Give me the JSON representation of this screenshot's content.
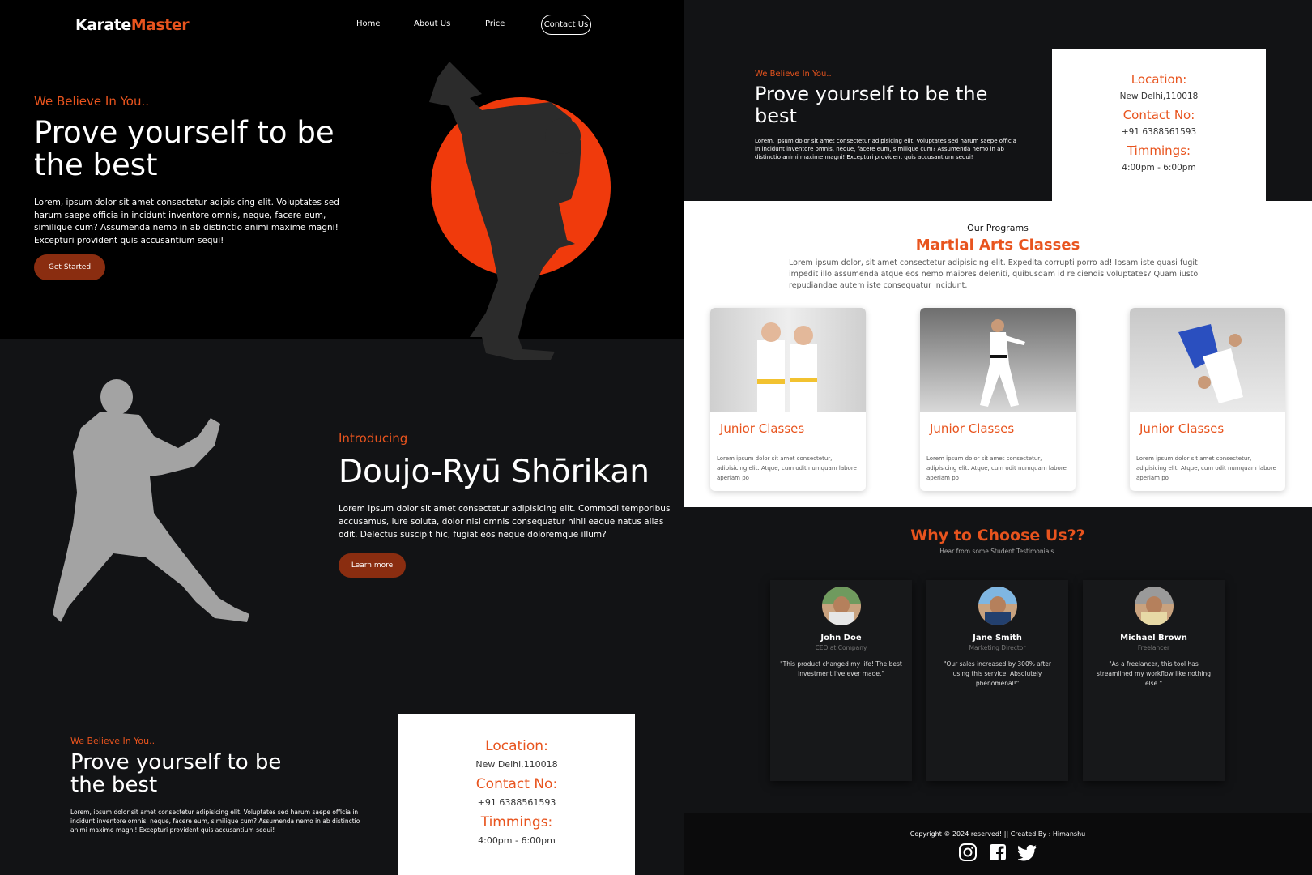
{
  "nav": {
    "logo_a": "Karate",
    "logo_b": "Master",
    "items": [
      "Home",
      "About Us",
      "Price",
      "Contact Us"
    ]
  },
  "hero": {
    "kicker": "We Believe In You..",
    "title": "Prove yourself to be the best",
    "body": "Lorem, ipsum dolor sit amet consectetur adipisicing elit. Voluptates sed harum saepe officia in incidunt inventore omnis, neque, facere eum, similique cum? Assumenda nemo in ab distinctio animi maxime magni! Excepturi provident quis accusantium sequi!",
    "button": "Get Started"
  },
  "intro": {
    "kicker": "Introducing",
    "title": "Doujo-Ryū Shōrikan",
    "body": "Lorem ipsum dolor sit amet consectetur adipisicing elit. Commodi temporibus accusamus, iure soluta, dolor nisi omnis consequatur nihil eaque natus alias odit. Delectus suscipit hic, fugiat eos neque doloremque illum?",
    "button": "Learn more"
  },
  "location_section": {
    "kicker": "We Believe In You..",
    "title": "Prove yourself to be the best",
    "body": "Lorem, ipsum dolor sit amet consectetur adipisicing elit. Voluptates sed harum saepe officia in incidunt inventore omnis, neque, facere eum, similique cum? Assumenda nemo in ab distinctio animi maxime magni! Excepturi provident quis accusantium sequi!",
    "card": {
      "location_label": "Location:",
      "location": "New Delhi,110018",
      "contact_label": "Contact No:",
      "contact": "+91 6388561593",
      "timings_label": "Timmings:",
      "timings": "4:00pm - 6:00pm"
    }
  },
  "programs": {
    "label": "Our Programs",
    "title": "Martial Arts Classes",
    "body": "Lorem ipsum dolor, sit amet consectetur adipisicing elit. Expedita corrupti porro ad! Ipsam iste quasi fugit impedit illo assumenda atque eos nemo maiores deleniti, quibusdam id reiciendis voluptates? Quam iusto repudiandae autem iste consequatur incidunt.",
    "cards": [
      {
        "title": "Junior Classes",
        "body": "Lorem ipsum dolor sit amet consectetur, adipisicing elit. Atque, cum odit numquam labore aperiam po"
      },
      {
        "title": "Junior Classes",
        "body": "Lorem ipsum dolor sit amet consectetur, adipisicing elit. Atque, cum odit numquam labore aperiam po"
      },
      {
        "title": "Junior Classes",
        "body": "Lorem ipsum dolor sit amet consectetur, adipisicing elit. Atque, cum odit numquam labore aperiam po"
      }
    ]
  },
  "testimonials": {
    "title": "Why to Choose Us??",
    "subtitle": "Hear from some Student Testimonials.",
    "items": [
      {
        "name": "John Doe",
        "role": "CEO at Company",
        "quote": "\"This product changed my life! The best investment I've ever made.\""
      },
      {
        "name": "Jane Smith",
        "role": "Marketing Director",
        "quote": "\"Our sales increased by 300% after using this service. Absolutely phenomenal!\""
      },
      {
        "name": "Michael Brown",
        "role": "Freelancer",
        "quote": "\"As a freelancer, this tool has streamlined my workflow like nothing else.\""
      }
    ]
  },
  "footer": {
    "copyright": "Copyright © 2024 reserved! || Created By : Himanshu",
    "social_icons": [
      "instagram-icon",
      "facebook-icon",
      "twitter-icon"
    ]
  },
  "colors": {
    "accent": "#e8541e",
    "button": "#8a2d10",
    "sun": "#f03a0c",
    "dark": "#121315"
  }
}
